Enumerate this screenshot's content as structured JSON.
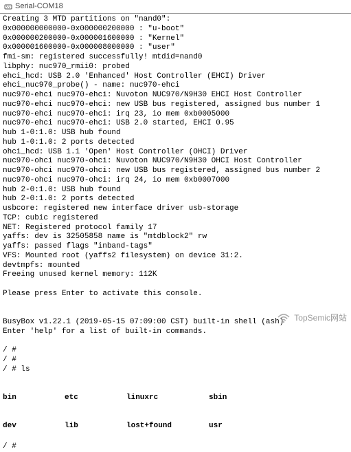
{
  "window": {
    "title": "Serial-COM18"
  },
  "terminal": {
    "lines": [
      "Creating 3 MTD partitions on \"nand0\":",
      "0x000000000000-0x000000200000 : \"u-boot\"",
      "0x000000200000-0x000001600000 : \"Kernel\"",
      "0x000001600000-0x000008000000 : \"user\"",
      "fmi-sm: registered successfully! mtdid=nand0",
      "libphy: nuc970_rmii0: probed",
      "ehci_hcd: USB 2.0 'Enhanced' Host Controller (EHCI) Driver",
      "ehci_nuc970_probe() - name: nuc970-ehci",
      "nuc970-ehci nuc970-ehci: Nuvoton NUC970/N9H30 EHCI Host Controller",
      "nuc970-ehci nuc970-ehci: new USB bus registered, assigned bus number 1",
      "nuc970-ehci nuc970-ehci: irq 23, io mem 0xb0005000",
      "nuc970-ehci nuc970-ehci: USB 2.0 started, EHCI 0.95",
      "hub 1-0:1.0: USB hub found",
      "hub 1-0:1.0: 2 ports detected",
      "ohci_hcd: USB 1.1 'Open' Host Controller (OHCI) Driver",
      "nuc970-ohci nuc970-ohci: Nuvoton NUC970/N9H30 OHCI Host Controller",
      "nuc970-ohci nuc970-ohci: new USB bus registered, assigned bus number 2",
      "nuc970-ohci nuc970-ohci: irq 24, io mem 0xb0007000",
      "hub 2-0:1.0: USB hub found",
      "hub 2-0:1.0: 2 ports detected",
      "usbcore: registered new interface driver usb-storage",
      "TCP: cubic registered",
      "NET: Registered protocol family 17",
      "yaffs: dev is 32505858 name is \"mtdblock2\" rw",
      "yaffs: passed flags \"inband-tags\"",
      "VFS: Mounted root (yaffs2 filesystem) on device 31:2.",
      "devtmpfs: mounted",
      "Freeing unused kernel memory: 112K",
      "",
      "Please press Enter to activate this console.",
      "",
      "",
      "BusyBox v1.22.1 (2019-05-15 07:09:00 CST) built-in shell (ash)",
      "Enter 'help' for a list of built-in commands.",
      ""
    ],
    "prompts": [
      "/ #",
      "/ #",
      "/ # ls"
    ],
    "ls": {
      "row1": {
        "c1": "bin",
        "c2": "etc",
        "c3": "linuxrc",
        "c4": "sbin"
      },
      "row2": {
        "c1": "dev",
        "c2": "lib",
        "c3": "lost+found",
        "c4": "usr"
      }
    },
    "prompt_after": "/ #"
  },
  "watermark": {
    "text": "TopSemic网站"
  }
}
